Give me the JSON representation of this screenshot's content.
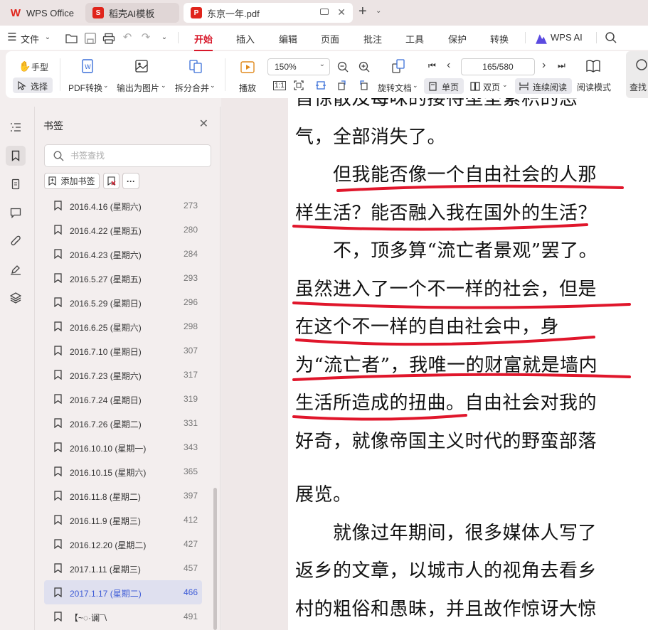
{
  "tabs": [
    {
      "label": "WPS Office",
      "icon": "wps-logo-icon"
    },
    {
      "label": "稻壳AI模板",
      "icon": "daoke-logo-icon"
    },
    {
      "label": "东京一年.pdf",
      "icon": "pdf-icon"
    }
  ],
  "menu": {
    "file_label": "文件",
    "items": [
      "开始",
      "插入",
      "编辑",
      "页面",
      "批注",
      "工具",
      "保护",
      "转换"
    ],
    "active": "开始",
    "wps_ai_label": "WPS AI"
  },
  "toolbar": {
    "hand_label": "手型",
    "select_label": "选择",
    "pdf_convert_label": "PDF转换",
    "export_image_label": "输出为图片",
    "split_merge_label": "拆分合并",
    "play_label": "播放",
    "zoom_value": "150%",
    "rotate_label": "旋转文档",
    "page_input": "165/580",
    "single_label": "单页",
    "double_label": "双页",
    "continuous_label": "连续阅读",
    "read_mode_label": "阅读模式",
    "find_label": "查找"
  },
  "panel": {
    "title": "书签",
    "search_placeholder": "书签查找",
    "add_bookmark_label": "添加书签",
    "more_label": "···"
  },
  "bookmarks": [
    {
      "label": "2016.4.16  (星期六)",
      "page": "273"
    },
    {
      "label": "2016.4.22  (星期五)",
      "page": "280"
    },
    {
      "label": "2016.4.23  (星期六)",
      "page": "284"
    },
    {
      "label": "2016.5.27  (星期五)",
      "page": "293"
    },
    {
      "label": "2016.5.29  (星期日)",
      "page": "296"
    },
    {
      "label": "2016.6.25  (星期六)",
      "page": "298"
    },
    {
      "label": "2016.7.10  (星期日)",
      "page": "307"
    },
    {
      "label": "2016.7.23  (星期六)",
      "page": "317"
    },
    {
      "label": "2016.7.24  (星期日)",
      "page": "319"
    },
    {
      "label": "2016.7.26  (星期二)",
      "page": "331"
    },
    {
      "label": "2016.10.10  (星期一)",
      "page": "343"
    },
    {
      "label": "2016.10.15  (星期六)",
      "page": "365"
    },
    {
      "label": "2016.11.8  (星期二)",
      "page": "397"
    },
    {
      "label": "2016.11.9  (星期三)",
      "page": "412"
    },
    {
      "label": "2016.12.20  (星期二)",
      "page": "427"
    },
    {
      "label": "2017.1.11  (星期三)",
      "page": "457"
    },
    {
      "label": "2017.1.17  (星期二)",
      "page": "466"
    },
    {
      "label": "【~◌·谰¯\\",
      "page": "491"
    }
  ],
  "selected_bookmark": "2017.1.17  (星期二)",
  "document": {
    "page1_lines": [
      "旨惊散及每味的接待型垒紧积的恶",
      "气，全部消失了。",
      "　　但我能否像一个自由社会的人那",
      "样生活？能否融入我在国外的生活？",
      "　　不，顶多算“流亡者景观”罢了。",
      "虽然进入了一个不一样的社会，但是",
      "在这个不一样的自由社会中，身",
      "为“流亡者”，我唯一的财富就是墙内",
      "生活所造成的扭曲。自由社会对我的",
      "好奇，就像帝国主义时代的野蛮部落"
    ],
    "page2_lines": [
      "展览。",
      "　　就像过年期间，很多媒体人写了",
      "返乡的文章，以城市人的视角去看乡",
      "村的粗俗和愚昧，并且故作惊讶大惊"
    ]
  },
  "colors": {
    "accent_red": "#d8182a",
    "underline_red": "#e0162b",
    "selected_blue": "#3d5bd6"
  }
}
